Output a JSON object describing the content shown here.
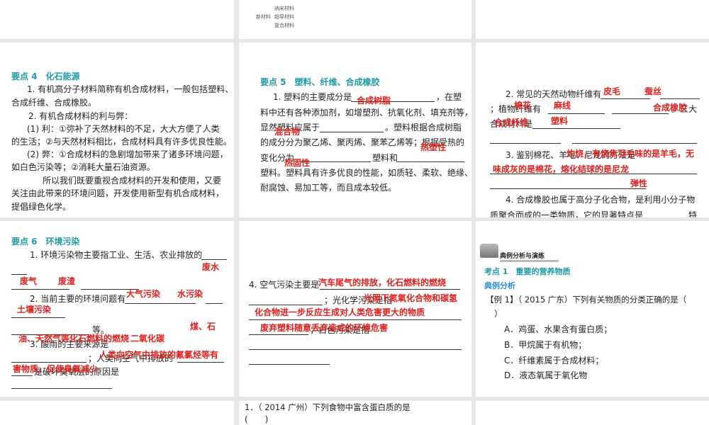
{
  "top_middle": {
    "new_material": "新材料",
    "items": [
      "纳米材料",
      "超导材料",
      "复合材料"
    ]
  },
  "p4": {
    "title": "要点 4　化石能源",
    "l1": "1. 有机高分子材料简称有机合成材料，一般包括塑料、",
    "l2": "合成纤维、合成橡胶。",
    "l3": "2. 有机合成材料的利与弊：",
    "l4": "(1) 利：①弥补了天然材料的不足，大大方便了人类",
    "l5": "的生活；②与天然材料相比，合成材料具有许多优良性能。",
    "l6": "(2) 弊：①合成材料的急剧增加带来了诸多环境问题，",
    "l7": "如白色污染等；②消耗大量石油资源。",
    "l8": "所以我们既要重视合成材料的开发和使用，又要",
    "l9": "关注由此带来的环境问题，开发使用新型有机合成材料，",
    "l10": "提倡绿色化学。"
  },
  "p5": {
    "title": "要点 5　塑料、纤维、合成橡胶",
    "l1": "1. 塑料的主要成分是",
    "l1b": "，在塑",
    "l2": "料中还有各种添加剂，如增塑剂、抗氧化剂、填充剂等，",
    "l3": "显然塑料应属于",
    "l3b": "。塑料根据合成树脂",
    "l4": "的成分分为聚乙烯、聚丙烯、聚苯乙烯等；根据受热的",
    "l5": "变化分为",
    "l5b": "塑料和",
    "l6": "塑料。塑料具有许多优良的性能，如质轻、柔软、绝缘、",
    "l7": "耐腐蚀、易加工等，而且成本较低。",
    "answers": [
      "合成树脂",
      "混合物",
      "热塑性",
      "热固性"
    ]
  },
  "p_fiber": {
    "l1": "2. 常见的天然动物纤维有",
    "l2": "；植物纤维有",
    "l2b": "。三大",
    "l3": "合成材料是",
    "l5": "3. 鉴别棉花、羊毛、尼龙的方法是",
    "l8": "4. 合成橡胶也属于高分子化合物，是利用小分子物",
    "l9": "质聚合而成的一类物质，它的显著特点是",
    "l9b": "特",
    "answers": [
      "皮毛",
      "蚕丝",
      "棉花",
      "麻线",
      "合成橡胶",
      "合成纤维",
      "塑料",
      "灼烧，有烧焦羽毛味的是羊毛，无",
      "味成灰的是棉花，熔化结球的是尼龙",
      "弹性"
    ]
  },
  "p6": {
    "title": "要点 6　环境污染",
    "l1": "1. 环境污染物主要指工业、生活、农业排放的",
    "l3": "2. 当前主要的环境问题有",
    "l5": "等。",
    "l6": "3. 酸雨的主要来源是",
    "l7": "；人类向空气中排放的",
    "l8": "是破坏臭氧层的原因是",
    "answers": [
      "废水",
      "废气",
      "废渣",
      "大气污染",
      "水污染",
      "土壤污染",
      "煤、石",
      "油、天然气等化石燃料的燃烧",
      "二氧化碳",
      "人类向空气中排放的氟氯烃等有",
      "害物质，促使臭氧减少"
    ]
  },
  "p_air": {
    "l1": "4. 空气污染主要是",
    "l2": "；光化学污染是指",
    "l4": "；白色污染是指",
    "answers": [
      "汽车尾气的排放，化石燃料的燃烧",
      "光照下氮氧化合物和碳氢",
      "化合物进一步反应生成对人类危害更大的物质",
      "废弃塑料随意丢弃造成的环境危害"
    ]
  },
  "p_ex": {
    "banner": "典例分析与演练",
    "kaodian": "考点 1　重要的营养物质",
    "sub": "典例分析",
    "q": "【例 1】（ 2015 广东）下列有关物质的分类正确的是（",
    "q2": "）",
    "opts": [
      "A．鸡蛋、水果含有蛋白质；",
      "B．甲烷属于有机物；",
      "C．纤维素属于合成材料；",
      "D．液态氧属于氧化物"
    ]
  },
  "bottom": {
    "q": "1．（ 2014 广州）下列食物中富含蛋白质的是",
    "paren": "(　　)"
  }
}
